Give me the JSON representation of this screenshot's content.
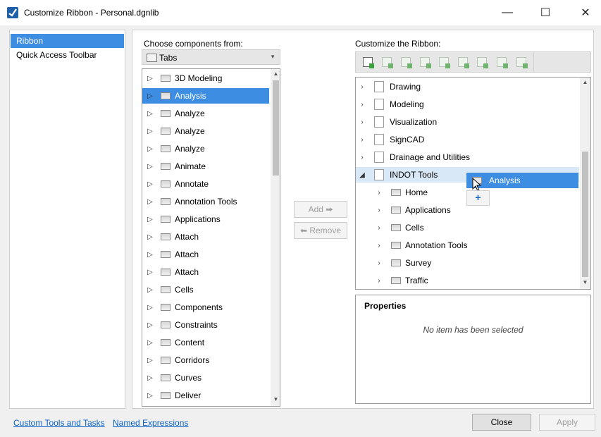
{
  "window": {
    "title": "Customize Ribbon - Personal.dgnlib",
    "minimize": "—",
    "maximize": "☐",
    "close": "✕"
  },
  "nav": {
    "items": [
      {
        "label": "Ribbon",
        "selected": true
      },
      {
        "label": "Quick Access Toolbar",
        "selected": false
      }
    ]
  },
  "left_panel": {
    "label": "Choose components from:",
    "source_value": "Tabs",
    "items": [
      "3D Modeling",
      "Analysis",
      "Analyze",
      "Analyze",
      "Analyze",
      "Animate",
      "Annotate",
      "Annotation Tools",
      "Applications",
      "Attach",
      "Attach",
      "Attach",
      "Cells",
      "Components",
      "Constraints",
      "Content",
      "Corridors",
      "Curves",
      "Deliver"
    ],
    "selected_index": 1
  },
  "middle": {
    "add_label": "Add ➡",
    "remove_label": "⬅ Remove"
  },
  "right_panel": {
    "label": "Customize the Ribbon:",
    "groups": [
      "Drawing",
      "Modeling",
      "Visualization",
      "SignCAD",
      "Drainage and Utilities",
      "INDOT Tools"
    ],
    "expanded_children": [
      "Home",
      "Applications",
      "Cells",
      "Annotation Tools",
      "Survey",
      "Traffic"
    ],
    "drag_label": "Analysis",
    "drag_plus": "+"
  },
  "properties": {
    "title": "Properties",
    "empty_text": "No item has been selected"
  },
  "footer": {
    "link1": "Custom Tools and Tasks",
    "link2": "Named Expressions",
    "close_label": "Close",
    "apply_label": "Apply"
  },
  "colors": {
    "selection": "#3d8ee2",
    "link": "#0b62c4"
  }
}
